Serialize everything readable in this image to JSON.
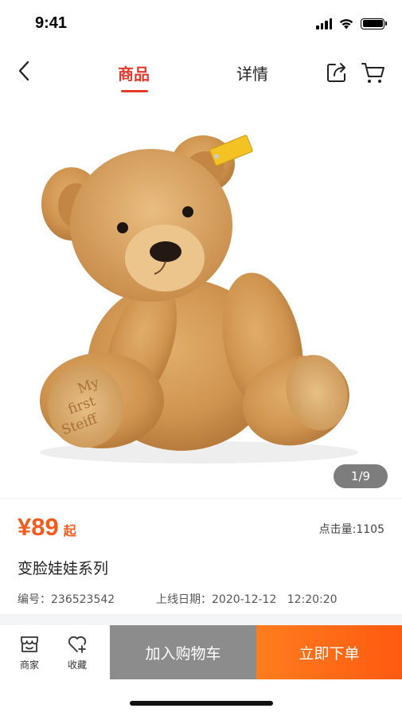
{
  "status_bar": {
    "time": "9:41"
  },
  "nav": {
    "tabs": [
      {
        "label": "商品",
        "active": true
      },
      {
        "label": "详情",
        "active": false
      }
    ],
    "accent_color": "#e63a2e"
  },
  "gallery": {
    "page_indicator": "1/9",
    "image_subject": "teddy bear plush",
    "foot_text": [
      "My",
      "first",
      "Steiff"
    ]
  },
  "product": {
    "price": "¥89",
    "price_suffix": "起",
    "clicks": "点击量:1105",
    "title": "变脸娃娃系列",
    "code": "编号：236523542",
    "online_date": "上线日期：2020-12-12   12:20:20",
    "price_color": "#f35b1f"
  },
  "bottom_bar": {
    "shop_label": "商家",
    "favorite_label": "收藏",
    "add_to_cart": "加入购物车",
    "buy_now": "立即下单"
  },
  "icons": [
    "back-icon",
    "share-icon",
    "cart-icon",
    "shop-icon",
    "favorite-icon",
    "signal-icon",
    "wifi-icon",
    "battery-icon"
  ]
}
